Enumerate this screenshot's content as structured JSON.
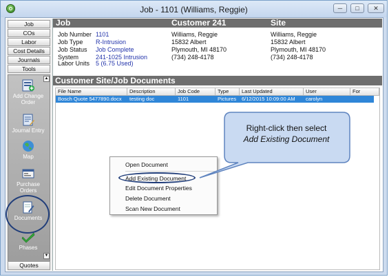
{
  "window": {
    "title": "Job - 1101 (Williams, Reggie)",
    "min_label": "─",
    "max_label": "□",
    "close_label": "✕"
  },
  "sidebar": {
    "tabs": [
      "Job",
      "COs",
      "Labor",
      "Cost Details",
      "Journals",
      "Tools"
    ],
    "tools": [
      {
        "label": "Add Change Order",
        "icon": "add-change-order-icon"
      },
      {
        "label": "Journal Entry",
        "icon": "journal-entry-icon"
      },
      {
        "label": "Map",
        "icon": "globe-map-icon"
      },
      {
        "label": "Purchase Orders",
        "icon": "purchase-order-icon"
      },
      {
        "label": "Documents",
        "icon": "documents-icon"
      },
      {
        "label": "Phases",
        "icon": "checkmark-phases-icon"
      }
    ],
    "bottom_tab": "Quotes"
  },
  "header": {
    "col1": "Job",
    "col2": "Customer 241",
    "col3": "Site"
  },
  "job": {
    "fields": [
      {
        "label": "Job Number",
        "value": "1101"
      },
      {
        "label": "Job Type",
        "value": "R-Intrusion"
      },
      {
        "label": "Job Status",
        "value": "Job Complete"
      },
      {
        "label": "System",
        "value": "241-1025 Intrusion"
      },
      {
        "label": "Labor Units",
        "value": "5 (6.75 Used)"
      }
    ]
  },
  "customer": {
    "name": "Williams, Reggie",
    "address": "15832 Albert",
    "city": "Plymouth, MI 48170",
    "phone": "(734) 248-4178"
  },
  "site": {
    "name": "Williams, Reggie",
    "address": "15832 Albert",
    "city": "Plymouth, MI 48170",
    "phone": "(734) 248-4178"
  },
  "documents": {
    "title": "Customer Site/Job Documents",
    "columns": [
      "File Name",
      "Description",
      "Job Code",
      "Type",
      "Last Updated",
      "User",
      "For"
    ],
    "rows": [
      [
        "Bosch Quote 5477890.docx",
        "testing doc",
        "1101",
        "Pictures",
        "6/12/2015 10:09:00 AM",
        "carolyn",
        ""
      ]
    ]
  },
  "context_menu": {
    "items": [
      "Open Document",
      "Add Existing Document",
      "Edit Document Properties",
      "Delete Document",
      "Scan New Document"
    ]
  },
  "callout": {
    "line1": "Right-click then select",
    "line2": "Add Existing Document"
  },
  "colors": {
    "header_bg": "#6e6e6e",
    "selection": "#2f86d8",
    "callout_fill": "#c9daf2",
    "accent_ring": "#213e7a"
  }
}
